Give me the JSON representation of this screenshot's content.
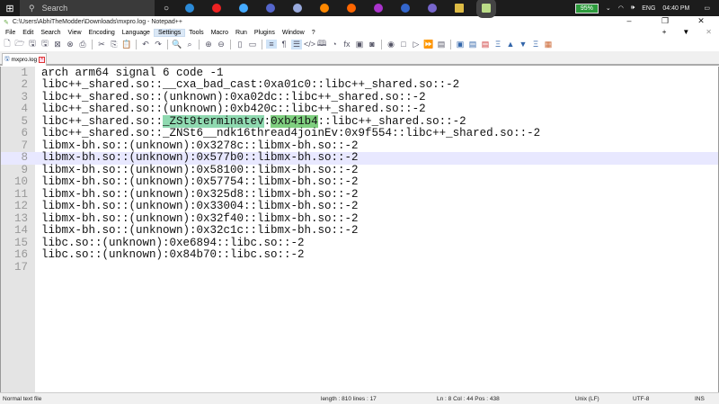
{
  "taskbar": {
    "search_placeholder": "Search",
    "battery": "95%",
    "language": "ENG",
    "time": "04:40 PM"
  },
  "window": {
    "title": "C:\\Users\\AbhiTheModder\\Downloads\\mxpro.log - Notepad++"
  },
  "menu": [
    "File",
    "Edit",
    "Search",
    "View",
    "Encoding",
    "Language",
    "Settings",
    "Tools",
    "Macro",
    "Run",
    "Plugins",
    "Window",
    "?"
  ],
  "tab": {
    "label": "mxpro.log"
  },
  "editor": {
    "current_line": 8,
    "lines": [
      "arch arm64 signal 6 code -1",
      "libc++_shared.so::__cxa_bad_cast:0xa01c0::libc++_shared.so::-2",
      "libc++_shared.so::(unknown):0xa02dc::libc++_shared.so::-2",
      "libc++_shared.so::(unknown):0xb420c::libc++_shared.so::-2",
      "",
      "libc++_shared.so::_ZNSt6__ndk16thread4joinEv:0x9f554::libc++_shared.so::-2",
      "libmx-bh.so::(unknown):0x3278c::libmx-bh.so::-2",
      "libmx-bh.so::(unknown):0x577b0::libmx-bh.so::-2",
      "libmx-bh.so::(unknown):0x58100::libmx-bh.so::-2",
      "libmx-bh.so::(unknown):0x57754::libmx-bh.so::-2",
      "libmx-bh.so::(unknown):0x325d8::libmx-bh.so::-2",
      "libmx-bh.so::(unknown):0x33004::libmx-bh.so::-2",
      "libmx-bh.so::(unknown):0x32f40::libmx-bh.so::-2",
      "libmx-bh.so::(unknown):0x32c1c::libmx-bh.so::-2",
      "libc.so::(unknown):0xe6894::libc.so::-2",
      "libc.so::(unknown):0x84b70::libc.so::-2",
      ""
    ],
    "line5": {
      "a": "libc++_shared.so::",
      "b": "_ZSt9terminatev",
      "c": ":",
      "d": "0xb41b4",
      "e": "::libc++_shared.so::-2"
    }
  },
  "status": {
    "type": "Normal text file",
    "length": "length : 810    lines : 17",
    "position": "Ln : 8    Col : 44    Pos : 438",
    "eol": "Unix (LF)",
    "encoding": "UTF-8",
    "mode": "INS"
  }
}
